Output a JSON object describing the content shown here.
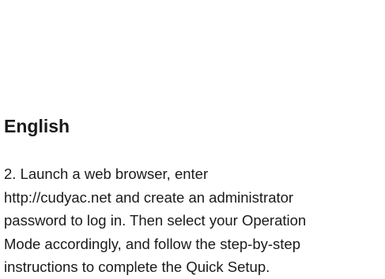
{
  "heading": "English",
  "instruction_lines": [
    "2. Launch a web browser, enter",
    "http://cudyac.net and create an administrator",
    "password to log in. Then select your Operation",
    "Mode accordingly, and follow the step-by-step",
    "instructions to complete the Quick Setup."
  ]
}
